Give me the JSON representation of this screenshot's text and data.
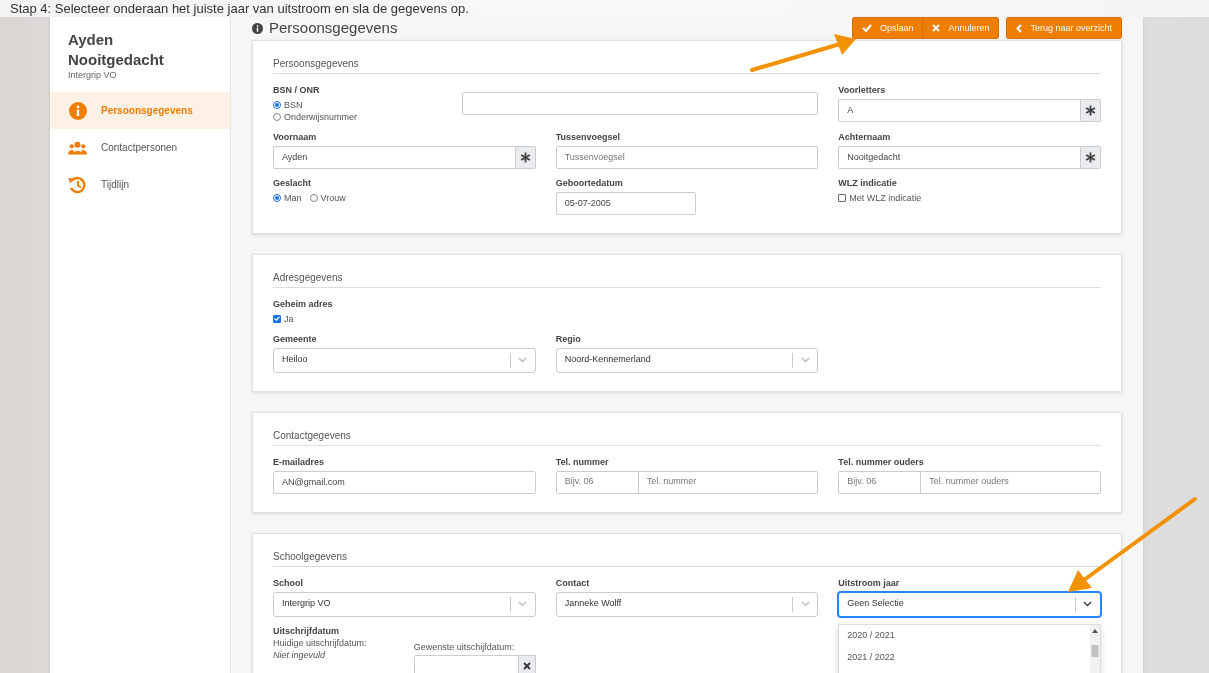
{
  "instruction": "Stap 4: Selecteer onderaan het juiste jaar van uitstroom en sla de gegevens op.",
  "sidebar": {
    "name": "Ayden Nooitgedacht",
    "organisation": "Intergrip VO",
    "items": [
      {
        "label": "Persoonsgegevens",
        "selected": true
      },
      {
        "label": "Contactpersonen",
        "selected": false
      },
      {
        "label": "Tijdlijn",
        "selected": false
      }
    ]
  },
  "header": {
    "title": "Persoonsgegevens",
    "buttons": [
      {
        "label": "Opslaan"
      },
      {
        "label": "Annuleren"
      },
      {
        "label": "Terug naar overzicht"
      }
    ]
  },
  "cards": [
    {
      "title": "Persoonsgegevens",
      "rows": [
        [
          {
            "kind": "radio_input",
            "label": "BSN / ONR",
            "options": [
              {
                "label": "BSN",
                "selected": true
              },
              {
                "label": "Onderwijsnummer",
                "selected": false
              }
            ]
          },
          "",
          {
            "kind": "text",
            "label": "Voorletters",
            "value": "A",
            "required": true
          }
        ],
        [
          {
            "kind": "text",
            "label": "Voornaam",
            "value": "Ayden",
            "required": true
          },
          {
            "kind": "text",
            "label": "Tussenvoegsel",
            "placeholder": "Tussenvoegsel",
            "required": false
          },
          {
            "kind": "text",
            "label": "Achternaam",
            "value": "Nooitgedacht",
            "required": true
          }
        ],
        [
          {
            "kind": "radio",
            "label": "Geslacht",
            "options": [
              {
                "label": "Man",
                "selected": true
              },
              {
                "label": "Vrouw",
                "selected": false
              }
            ]
          },
          {
            "kind": "date",
            "label": "Geboortedatum",
            "value": "05-07-2005"
          },
          {
            "kind": "checkbox",
            "label": "WLZ indicatie",
            "options": [
              {
                "label": "Met WLZ indicatie",
                "checked": false
              }
            ]
          }
        ]
      ]
    },
    {
      "title": "Adresgegevens",
      "rows": [
        [
          {
            "kind": "checkbox",
            "label": "Geheim adres",
            "options": [
              {
                "label": "Ja",
                "checked": true
              }
            ]
          }
        ],
        [
          {
            "kind": "select",
            "label": "Gemeente",
            "value": "Heiloo",
            "focused": false
          },
          {
            "kind": "select",
            "label": "Regio",
            "value": "Noord-Kennemerland",
            "focused": false
          }
        ]
      ]
    },
    {
      "title": "Contactgegevens",
      "rows": [
        [
          {
            "kind": "text",
            "label": "E-mailadres",
            "value": "AN@gmail.com",
            "required": false
          },
          {
            "kind": "phone",
            "label": "Tel. nummer",
            "prefix_placeholder": "Bijv. 06",
            "placeholder": "Tel. nummer"
          },
          {
            "kind": "phone",
            "label": "Tel. nummer ouders",
            "prefix_placeholder": "Bijv. 06",
            "placeholder": "Tel. nummer ouders"
          }
        ]
      ]
    },
    {
      "title": "Schoolgegevens",
      "rows": [
        [
          {
            "kind": "select",
            "label": "School",
            "value": "Intergrip VO",
            "focused": false
          },
          {
            "kind": "select",
            "label": "Contact",
            "value": "Janneke Wolff",
            "focused": false
          },
          {
            "kind": "select",
            "label": "Uitstroom jaar",
            "value": "Geen Selectie",
            "focused": true,
            "options": [
              {
                "label": "2020 / 2021"
              },
              {
                "label": "2021 / 2022"
              }
            ]
          }
        ],
        [
          {
            "kind": "dates",
            "label": "Uitschrijfdatum",
            "current_label": "Huidige uitschrijfdatum:",
            "current_value": "Niet ingevuld",
            "wanted_label": "Gewenste uitschijfdatum:"
          }
        ]
      ]
    }
  ]
}
